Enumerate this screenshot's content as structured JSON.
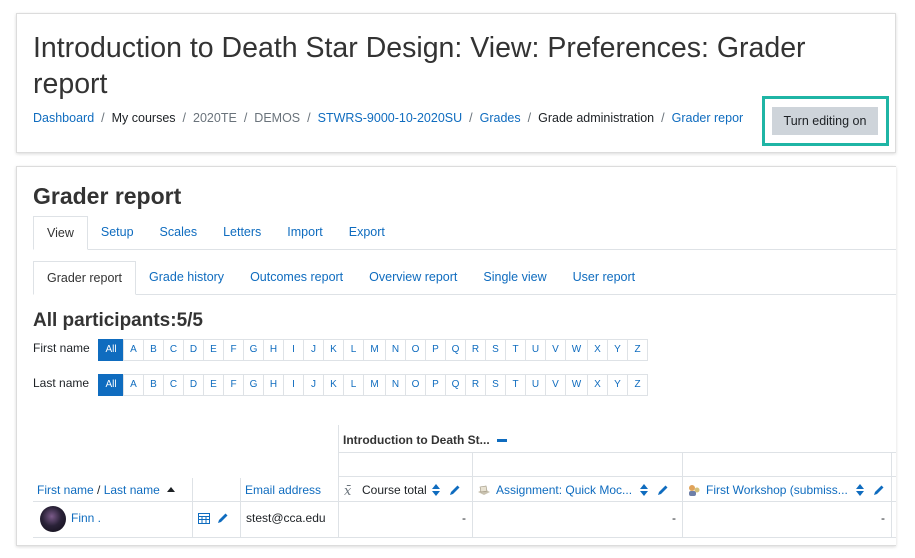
{
  "page_title": "Introduction to Death Star Design: View: Preferences: Grader report",
  "breadcrumb": [
    {
      "label": "Dashboard",
      "kind": "link"
    },
    {
      "label": "My courses",
      "kind": "plain"
    },
    {
      "label": "2020TE",
      "kind": "muted"
    },
    {
      "label": "DEMOS",
      "kind": "muted"
    },
    {
      "label": "STWRS-9000-10-2020SU",
      "kind": "link"
    },
    {
      "label": "Grades",
      "kind": "link"
    },
    {
      "label": "Grade administration",
      "kind": "plain"
    },
    {
      "label": "Grader repor",
      "kind": "link"
    }
  ],
  "edit_button_label": "Turn editing on",
  "section_title": "Grader report",
  "primary_tabs": [
    {
      "label": "View",
      "active": true
    },
    {
      "label": "Setup",
      "active": false
    },
    {
      "label": "Scales",
      "active": false
    },
    {
      "label": "Letters",
      "active": false
    },
    {
      "label": "Import",
      "active": false
    },
    {
      "label": "Export",
      "active": false
    }
  ],
  "secondary_tabs": [
    {
      "label": "Grader report",
      "active": true
    },
    {
      "label": "Grade history",
      "active": false
    },
    {
      "label": "Outcomes report",
      "active": false
    },
    {
      "label": "Overview report",
      "active": false
    },
    {
      "label": "Single view",
      "active": false
    },
    {
      "label": "User report",
      "active": false
    }
  ],
  "participants_label": "All participants:5/5",
  "first_name_label": "First name",
  "last_name_label": "Last name",
  "initials": [
    "All",
    "A",
    "B",
    "C",
    "D",
    "E",
    "F",
    "G",
    "H",
    "I",
    "J",
    "K",
    "L",
    "M",
    "N",
    "O",
    "P",
    "Q",
    "R",
    "S",
    "T",
    "U",
    "V",
    "W",
    "X",
    "Y",
    "Z"
  ],
  "table": {
    "category_header": "Introduction to Death St...",
    "col_first_name": "First name",
    "col_name_sep": " / ",
    "col_last_name": "Last name",
    "col_email": "Email address",
    "col_course_total": "Course total",
    "col_assignment": "Assignment: Quick Moc...",
    "col_workshop": "First Workshop (submiss...",
    "rows": [
      {
        "name": "Finn .",
        "email": "stest@cca.edu",
        "course_total": "-",
        "assignment": "-",
        "workshop": "-"
      }
    ]
  },
  "colors": {
    "link": "#0f6cbf",
    "highlight": "#1fb5a5",
    "button": "#ced4da"
  }
}
